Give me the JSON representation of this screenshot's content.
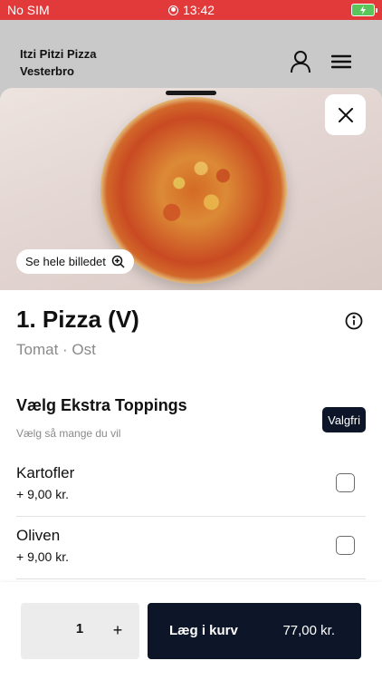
{
  "status_bar": {
    "carrier": "No SIM",
    "time": "13:42"
  },
  "header": {
    "store_name_line1": "Itzi Pitzi Pizza",
    "store_name_line2": "Vesterbro"
  },
  "hero": {
    "see_image_label": "Se hele billedet"
  },
  "product": {
    "title": "1. Pizza (V)",
    "subtitle": "Tomat · Ost"
  },
  "toppings": {
    "title": "Vælg Ekstra Toppings",
    "subtitle": "Vælg så mange du vil",
    "badge": "Valgfri",
    "options": [
      {
        "name": "Kartofler",
        "price": "+ 9,00 kr."
      },
      {
        "name": "Oliven",
        "price": "+ 9,00 kr."
      }
    ]
  },
  "footer": {
    "quantity": "1",
    "plus": "+",
    "add_label": "Læg i kurv",
    "total": "77,00 kr."
  },
  "colors": {
    "status_bar": "#e23a3a",
    "primary_dark": "#0d1528",
    "header_overlay": "#c9c9c9"
  },
  "icons": [
    "record-icon",
    "battery-icon",
    "user-icon",
    "menu-icon",
    "close-icon",
    "zoom-icon",
    "info-icon"
  ]
}
